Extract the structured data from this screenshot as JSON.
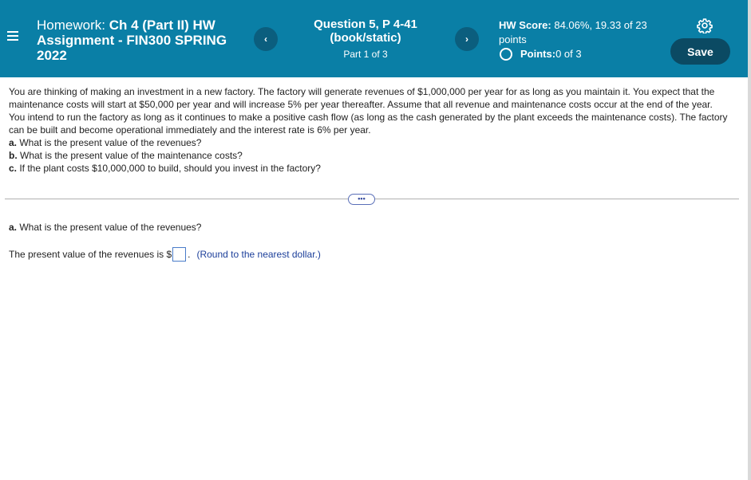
{
  "header": {
    "title_prefix": "Homework: ",
    "title_bold": "Ch 4 (Part II) HW Assignment - FIN300 SPRING 2022",
    "question": "Question 5, P 4-41 (book/static)",
    "part": "Part 1 of 3",
    "hw_score_label": "HW Score:",
    "hw_score_value": " 84.06%, 19.33 of 23 points",
    "points_label": "Points:",
    "points_value": " 0 of 3",
    "save_label": "Save",
    "prev_glyph": "‹",
    "next_glyph": "›"
  },
  "problem": {
    "intro": "You are thinking of making an investment in a new factory. The factory will generate revenues of $1,000,000 per year for as long as you maintain it. You expect that the maintenance costs will start at $50,000 per year and will increase 5% per year thereafter. Assume that all revenue and maintenance costs occur at the end of the year. You intend to run the factory as long as it continues to make a positive cash flow (as long as the cash generated by the plant exceeds the maintenance costs). The factory can be built and become operational immediately and the interest rate is 6% per year.",
    "a_label": "a.",
    "a_text": " What is the present value of the revenues?",
    "b_label": "b.",
    "b_text": " What is the present value of the maintenance costs?",
    "c_label": "c.",
    "c_text": " If the plant costs $10,000,000 to build, should you invest in the factory?"
  },
  "more_label": "•••",
  "part_a": {
    "label": "a.",
    "question": " What is the present value of the revenues?",
    "answer_prefix": "The present value of the revenues is $",
    "answer_suffix": ".",
    "hint": "(Round to the nearest dollar.)"
  },
  "colors": {
    "header_bg": "#0a7fa6",
    "nav_btn": "#0b5e7e",
    "save_btn": "#0b4a63",
    "hint_text": "#1c3f9a"
  },
  "icons": [
    "menu-icon",
    "chevron-left-icon",
    "chevron-right-icon",
    "gear-icon",
    "circle-icon"
  ]
}
